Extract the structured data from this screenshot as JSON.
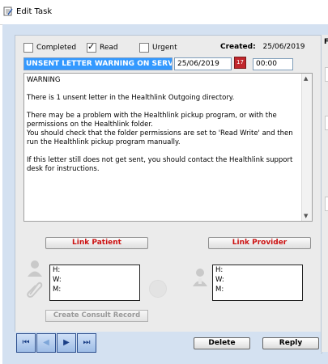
{
  "window": {
    "title": "Edit Task"
  },
  "flags": {
    "completed": {
      "label": "Completed",
      "checked": false
    },
    "read": {
      "label": "Read",
      "checked": true
    },
    "urgent": {
      "label": "Urgent",
      "checked": false
    }
  },
  "created": {
    "label": "Created:",
    "value": "25/06/2019"
  },
  "task": {
    "subject": "UNSENT LETTER WARNING ON SERVER",
    "date": "25/06/2019",
    "time": "00:00",
    "body": "WARNING\n\nThere is 1 unsent letter in the Healthlink Outgoing directory.\n\nThere may be a problem with the Healthlink pickup program, or with the permissions on the Healthlink folder.\nYou should check that the folder permissions are set to 'Read Write' and then run the Healthlink pickup program manually.\n\nIf this letter still does not get sent, you should contact the Healthlink support desk for instructions."
  },
  "links": {
    "patient": "Link Patient",
    "provider": "Link Provider"
  },
  "patient_box": {
    "h": "H:",
    "w": "W:",
    "m": "M:"
  },
  "provider_box": {
    "h": "H:",
    "w": "W:",
    "m": "M:"
  },
  "consult_button": "Create Consult Record",
  "actions": {
    "delete": "Delete",
    "reply": "Reply"
  },
  "side_panel": {
    "label": "F"
  },
  "colors": {
    "accent": "#3399ff",
    "link_red": "#cc1111",
    "panel_blue": "#d4e1f1"
  }
}
